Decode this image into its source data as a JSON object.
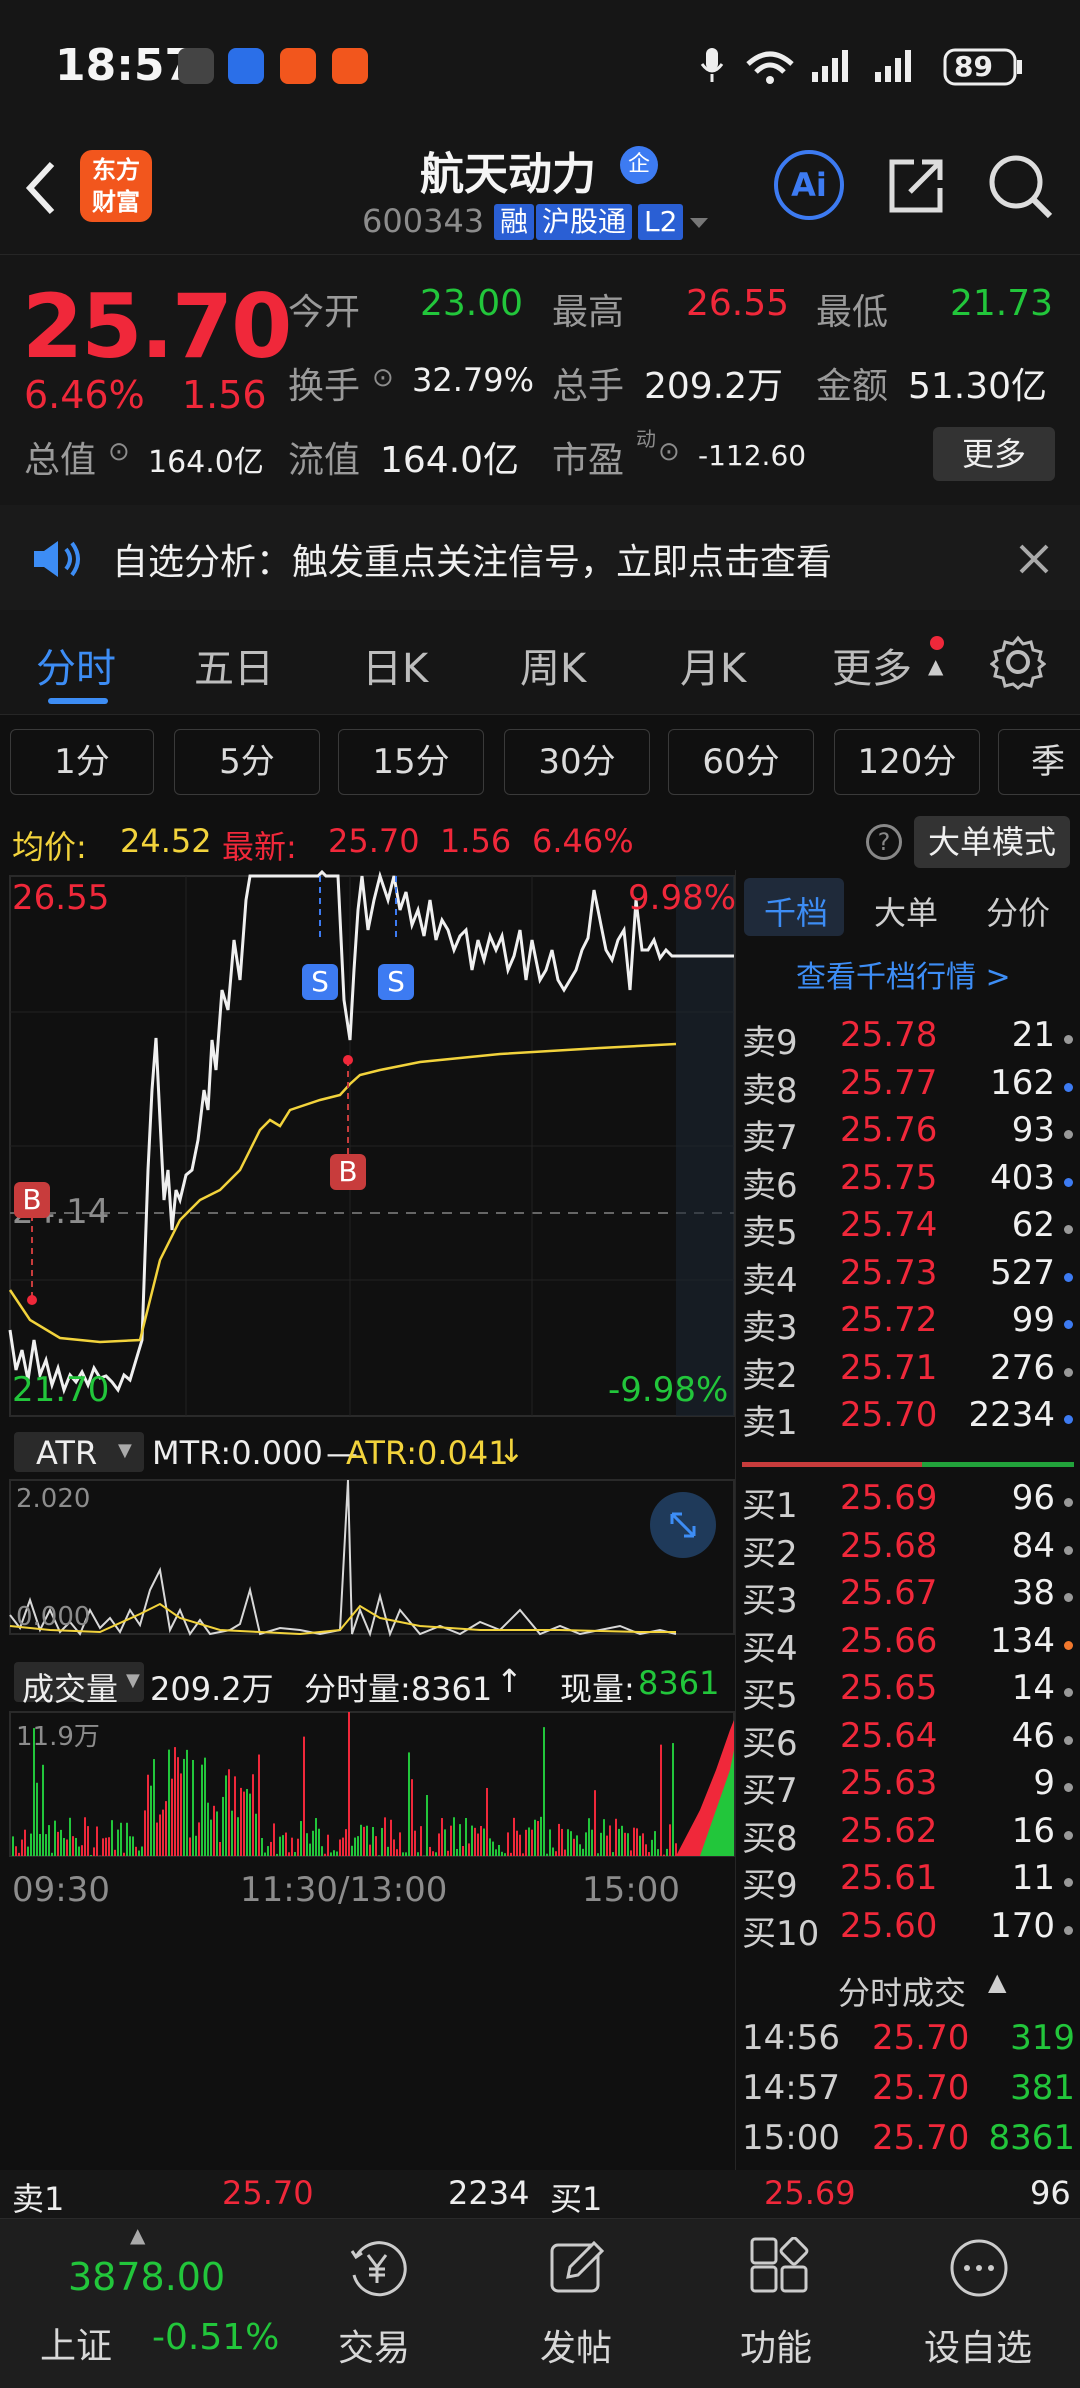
{
  "status": {
    "time": "18:57",
    "battery": "89",
    "signal": "4G"
  },
  "header": {
    "name": "航天动力",
    "badge": "企",
    "code": "600343",
    "tags": [
      "融",
      "沪股通",
      "L2"
    ]
  },
  "quote": {
    "price": "25.70",
    "pct": "6.46%",
    "change": "1.56",
    "open_label": "今开",
    "open": "23.00",
    "high_label": "最高",
    "high": "26.55",
    "low_label": "最低",
    "low": "21.73",
    "turnover_label": "换手",
    "turnover": "32.79%",
    "volume_label": "总手",
    "volume": "209.2万",
    "amount_label": "金额",
    "amount": "51.30亿",
    "mcap_label": "总值",
    "mcap": "164.0亿",
    "float_label": "流值",
    "float": "164.0亿",
    "pe_label": "市盈",
    "pe_sup": "动",
    "pe": "-112.60",
    "more": "更多"
  },
  "notice": {
    "text": "自选分析：触发重点关注信号，立即点击查看"
  },
  "tabs": [
    "分时",
    "五日",
    "日K",
    "周K",
    "月K",
    "更多"
  ],
  "periods": [
    "1分",
    "5分",
    "15分",
    "30分",
    "60分",
    "120分",
    "季"
  ],
  "avg_header": {
    "avg_label": "均价:",
    "avg": "24.52",
    "last_label": "最新:",
    "last": "25.70",
    "change": "1.56",
    "pct": "6.46%",
    "mode": "大单模式"
  },
  "chart": {
    "top_price": "26.55",
    "top_pct": "9.98%",
    "mid_price": "24.14",
    "bot_price": "21.70",
    "bot_pct": "-9.98%",
    "markers": [
      "S",
      "S",
      "B",
      "B"
    ]
  },
  "atr": {
    "name": "ATR",
    "mtr": "MTR:0.000",
    "atr": "ATR:0.041",
    "max": "2.020",
    "min": "0.000"
  },
  "vol": {
    "name": "成交量",
    "total": "209.2万",
    "tick_label": "分时量:8361",
    "now_label": "现量:",
    "now": "8361",
    "max": "11.9万",
    "times": [
      "09:30",
      "11:30/13:00",
      "15:00"
    ]
  },
  "book": {
    "tabs": [
      "千档",
      "大单",
      "分价"
    ],
    "link": "查看千档行情 >",
    "asks": [
      {
        "l": "卖9",
        "p": "25.78",
        "v": "21"
      },
      {
        "l": "卖8",
        "p": "25.77",
        "v": "162"
      },
      {
        "l": "卖7",
        "p": "25.76",
        "v": "93"
      },
      {
        "l": "卖6",
        "p": "25.75",
        "v": "403"
      },
      {
        "l": "卖5",
        "p": "25.74",
        "v": "62"
      },
      {
        "l": "卖4",
        "p": "25.73",
        "v": "527"
      },
      {
        "l": "卖3",
        "p": "25.72",
        "v": "99"
      },
      {
        "l": "卖2",
        "p": "25.71",
        "v": "276"
      },
      {
        "l": "卖1",
        "p": "25.70",
        "v": "2234"
      }
    ],
    "bids": [
      {
        "l": "买1",
        "p": "25.69",
        "v": "96"
      },
      {
        "l": "买2",
        "p": "25.68",
        "v": "84"
      },
      {
        "l": "买3",
        "p": "25.67",
        "v": "38"
      },
      {
        "l": "买4",
        "p": "25.66",
        "v": "134"
      },
      {
        "l": "买5",
        "p": "25.65",
        "v": "14"
      },
      {
        "l": "买6",
        "p": "25.64",
        "v": "46"
      },
      {
        "l": "买7",
        "p": "25.63",
        "v": "9"
      },
      {
        "l": "买8",
        "p": "25.62",
        "v": "16"
      },
      {
        "l": "买9",
        "p": "25.61",
        "v": "11"
      },
      {
        "l": "买10",
        "p": "25.60",
        "v": "170"
      }
    ],
    "trades_title": "分时成交",
    "trades": [
      {
        "t": "14:56",
        "p": "25.70",
        "v": "319"
      },
      {
        "t": "14:57",
        "p": "25.70",
        "v": "381"
      },
      {
        "t": "15:00",
        "p": "25.70",
        "v": "8361"
      }
    ]
  },
  "strip": {
    "ask_label": "卖1",
    "ask_p": "25.70",
    "ask_v": "2234",
    "bid_label": "买1",
    "bid_p": "25.69",
    "bid_v": "96"
  },
  "nav": {
    "index_value": "3878.00",
    "index_name": "上证",
    "index_pct": "-0.51%",
    "items": [
      "交易",
      "发帖",
      "功能",
      "设自选"
    ]
  }
}
